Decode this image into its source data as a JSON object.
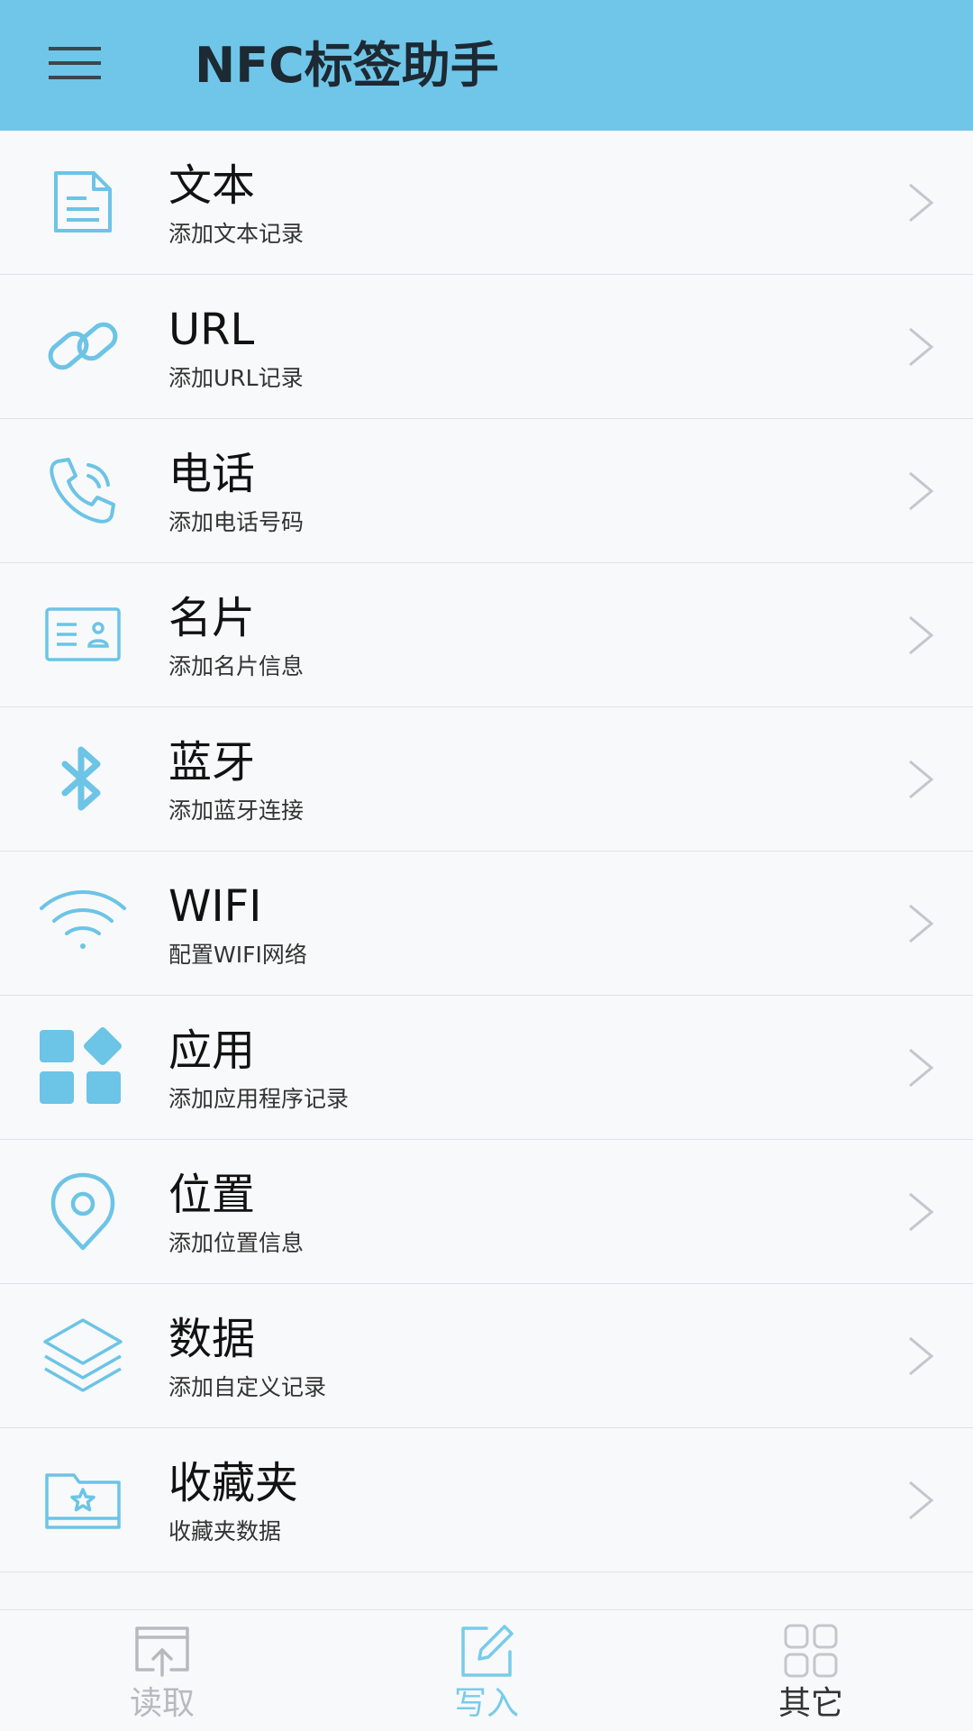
{
  "app": {
    "title": "NFC标签助手"
  },
  "colors": {
    "accent": "#6fc6e8",
    "icon": "#6cc4e6",
    "tab_inactive": "#b7babd",
    "tab_active": "#79cbea",
    "tab_other": "#333333"
  },
  "items": [
    {
      "title": "文本",
      "subtitle": "添加文本记录",
      "icon": "document-icon"
    },
    {
      "title": "URL",
      "subtitle": "添加URL记录",
      "icon": "link-icon"
    },
    {
      "title": "电话",
      "subtitle": "添加电话号码",
      "icon": "phone-icon"
    },
    {
      "title": "名片",
      "subtitle": "添加名片信息",
      "icon": "business-card-icon"
    },
    {
      "title": "蓝牙",
      "subtitle": "添加蓝牙连接",
      "icon": "bluetooth-icon"
    },
    {
      "title": "WIFI",
      "subtitle": "配置WIFI网络",
      "icon": "wifi-icon"
    },
    {
      "title": "应用",
      "subtitle": "添加应用程序记录",
      "icon": "apps-icon"
    },
    {
      "title": "位置",
      "subtitle": "添加位置信息",
      "icon": "location-pin-icon"
    },
    {
      "title": "数据",
      "subtitle": "添加自定义记录",
      "icon": "layers-icon"
    },
    {
      "title": "收藏夹",
      "subtitle": "收藏夹数据",
      "icon": "favorites-folder-icon"
    }
  ],
  "tabs": [
    {
      "label": "读取",
      "icon": "read-icon",
      "state": "inactive"
    },
    {
      "label": "写入",
      "icon": "write-icon",
      "state": "active"
    },
    {
      "label": "其它",
      "icon": "grid-icon",
      "state": "normal"
    }
  ]
}
